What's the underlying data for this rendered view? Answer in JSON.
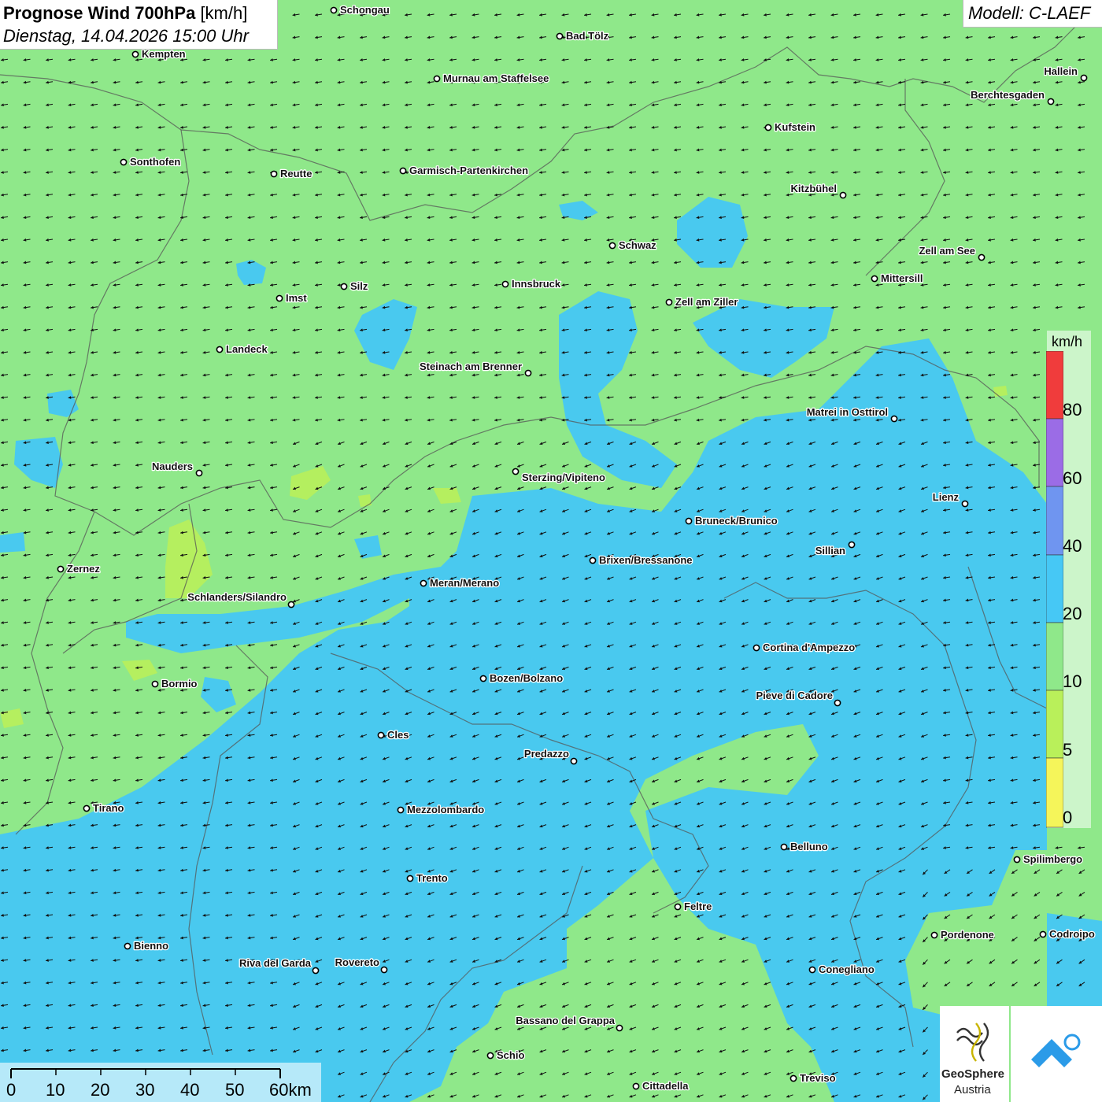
{
  "title": {
    "bold": "Prognose Wind 700hPa",
    "unit": "[km/h]",
    "datetime": "Dienstag, 14.04.2026 15:00 Uhr"
  },
  "model": "Modell: C-LAEF",
  "legend": {
    "unit": "km/h",
    "labels": [
      "0",
      "5",
      "10",
      "20",
      "40",
      "60",
      "80"
    ],
    "colors": {
      "0-5": "#f5f55a",
      "5-10": "#b9f05a",
      "10-20": "#8fe88a",
      "20-40": "#46c8f5",
      "40-60": "#6f95f0",
      "60-80": "#9b6ce6",
      "80+": "#f03c3c"
    }
  },
  "scale": {
    "labels": [
      "0",
      "10",
      "20",
      "30",
      "40",
      "50",
      "60km"
    ]
  },
  "logo": {
    "line1": "GeoSphere",
    "line2": "Austria"
  },
  "cities": [
    {
      "name": "Schongau"
    },
    {
      "name": "Bad Tölz"
    },
    {
      "name": "Kempten"
    },
    {
      "name": "Murnau am Staffelsee"
    },
    {
      "name": "Hallein"
    },
    {
      "name": "Berchtesgaden"
    },
    {
      "name": "Kufstein"
    },
    {
      "name": "Sonthofen"
    },
    {
      "name": "Reutte"
    },
    {
      "name": "Garmisch-Partenkirchen"
    },
    {
      "name": "Kitzbühel"
    },
    {
      "name": "Schwaz"
    },
    {
      "name": "Zell am See"
    },
    {
      "name": "Mittersill"
    },
    {
      "name": "Silz"
    },
    {
      "name": "Innsbruck"
    },
    {
      "name": "Imst"
    },
    {
      "name": "Zell am Ziller"
    },
    {
      "name": "Landeck"
    },
    {
      "name": "Steinach am Brenner"
    },
    {
      "name": "Matrei in Osttirol"
    },
    {
      "name": "Nauders"
    },
    {
      "name": "Sterzing/Vipiteno"
    },
    {
      "name": "Lienz"
    },
    {
      "name": "Bruneck/Brunico"
    },
    {
      "name": "Sillian"
    },
    {
      "name": "Zernez"
    },
    {
      "name": "Brixen/Bressanone"
    },
    {
      "name": "Meran/Merano"
    },
    {
      "name": "Schlanders/Silandro"
    },
    {
      "name": "Cortina d'Ampezzo"
    },
    {
      "name": "Bozen/Bolzano"
    },
    {
      "name": "Bormio"
    },
    {
      "name": "Pieve di Cadore"
    },
    {
      "name": "Cles"
    },
    {
      "name": "Predazzo"
    },
    {
      "name": "Tirano"
    },
    {
      "name": "Mezzolombardo"
    },
    {
      "name": "Belluno"
    },
    {
      "name": "Spilimbergo"
    },
    {
      "name": "Trento"
    },
    {
      "name": "Feltre"
    },
    {
      "name": "Pordenone"
    },
    {
      "name": "Codroipo"
    },
    {
      "name": "Bienno"
    },
    {
      "name": "Riva del Garda"
    },
    {
      "name": "Rovereto"
    },
    {
      "name": "Conegliano"
    },
    {
      "name": "Bassano del Grappa"
    },
    {
      "name": "Schio"
    },
    {
      "name": "Treviso"
    },
    {
      "name": "Cittadella"
    }
  ]
}
